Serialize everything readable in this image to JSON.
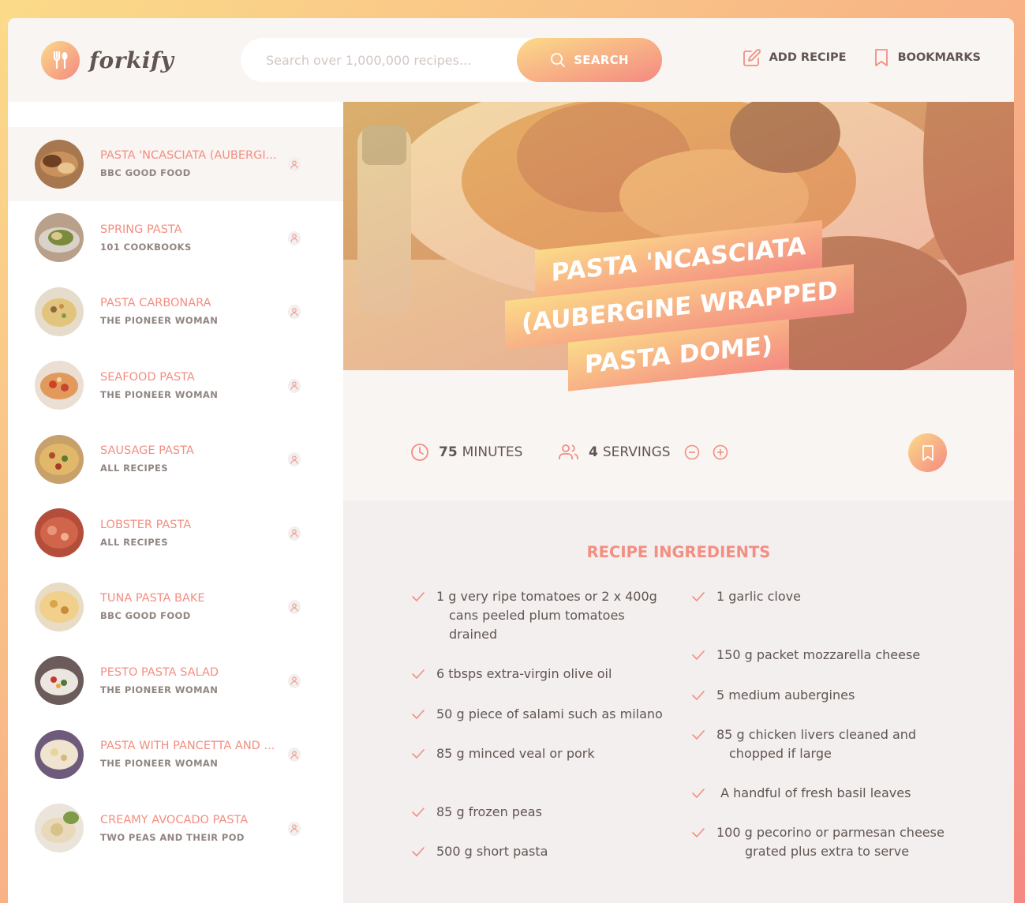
{
  "header": {
    "logo_text": "forkify",
    "search_placeholder": "Search over 1,000,000 recipes...",
    "search_label": "SEARCH",
    "add_recipe_label": "ADD RECIPE",
    "bookmarks_label": "BOOKMARKS"
  },
  "results": [
    {
      "title": "PASTA 'NCASCIATA (AUBERGI...",
      "publisher": "BBC GOOD FOOD"
    },
    {
      "title": "SPRING PASTA",
      "publisher": "101 COOKBOOKS"
    },
    {
      "title": "PASTA CARBONARA",
      "publisher": "THE PIONEER WOMAN"
    },
    {
      "title": "SEAFOOD PASTA",
      "publisher": "THE PIONEER WOMAN"
    },
    {
      "title": "SAUSAGE PASTA",
      "publisher": "ALL RECIPES"
    },
    {
      "title": "LOBSTER PASTA",
      "publisher": "ALL RECIPES"
    },
    {
      "title": "TUNA PASTA BAKE",
      "publisher": "BBC GOOD FOOD"
    },
    {
      "title": "PESTO PASTA SALAD",
      "publisher": "THE PIONEER WOMAN"
    },
    {
      "title": "PASTA WITH PANCETTA AND ...",
      "publisher": "THE PIONEER WOMAN"
    },
    {
      "title": "CREAMY AVOCADO PASTA",
      "publisher": "TWO PEAS AND THEIR POD"
    }
  ],
  "recipe": {
    "title": "PASTA 'NCASCIATA (AUBERGINE WRAPPED PASTA DOME)",
    "minutes": "75",
    "minutes_label": "MINUTES",
    "servings": "4",
    "servings_label": "SERVINGS",
    "ingredients_heading": "RECIPE INGREDIENTS",
    "ingredients_left": [
      {
        "line1": "1 g very ripe tomatoes or 2 x 400g",
        "line2": "cans peeled plum tomatoes drained"
      },
      {
        "line1": "6 tbsps extra-virgin olive oil",
        "line2": ""
      },
      {
        "line1": "50 g piece of salami such as milano",
        "line2": ""
      },
      {
        "line1": "85 g minced veal or pork",
        "line2": ""
      },
      {
        "line1": "85 g frozen peas",
        "line2": ""
      },
      {
        "line1": "500 g short pasta",
        "line2": ""
      }
    ],
    "ingredients_right": [
      {
        "line1": "1 garlic clove",
        "line2": ""
      },
      {
        "line1": "150 g packet mozzarella cheese",
        "line2": ""
      },
      {
        "line1": "5 medium aubergines",
        "line2": ""
      },
      {
        "line1": "85 g chicken livers cleaned and",
        "line2": "chopped if large"
      },
      {
        "line1": " A handful of fresh basil leaves",
        "line2": ""
      },
      {
        "line1": "100 g pecorino or parmesan cheese",
        "line2": "grated plus extra to serve"
      }
    ]
  },
  "colors": {
    "accent": "#f38e82",
    "gradient_start": "#fbdb89",
    "gradient_end": "#f48982",
    "text": "#615551",
    "panel_bg": "#f9f5f3"
  }
}
